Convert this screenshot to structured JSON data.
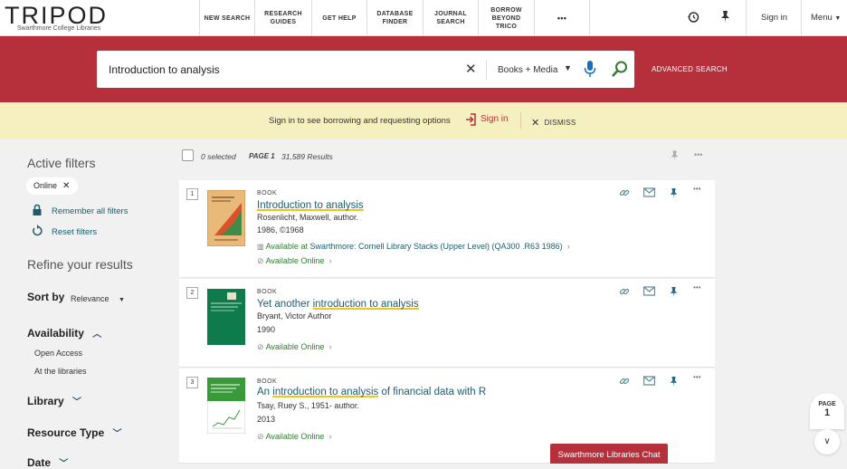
{
  "brand": {
    "title": "TRIPOD",
    "subtitle": "Swarthmore College Libraries"
  },
  "nav": {
    "new_search": "NEW SEARCH",
    "research_guides_1": "RESEARCH",
    "research_guides_2": "GUIDES",
    "get_help": "GET HELP",
    "database_finder_1": "DATABASE",
    "database_finder_2": "FINDER",
    "journal_search_1": "JOURNAL",
    "journal_search_2": "SEARCH",
    "borrow_1": "BORROW",
    "borrow_2": "BEYOND",
    "borrow_3": "TRICO",
    "more": "•••",
    "sign_in": "Sign in",
    "menu": "Menu"
  },
  "search": {
    "query": "Introduction to analysis",
    "scope": "Books + Media",
    "advanced": "ADVANCED SEARCH"
  },
  "banner": {
    "message": "Sign in to see borrowing and requesting options",
    "sign_in": "Sign in",
    "dismiss": "DISMISS"
  },
  "sidebar": {
    "active_filters": "Active filters",
    "chip": "Online",
    "remember": "Remember all filters",
    "reset": "Reset filters",
    "refine": "Refine your results",
    "sort_by": "Sort by",
    "sort_value": "Relevance",
    "availability": "Availability",
    "open_access": "Open Access",
    "at_libraries": "At the libraries",
    "library": "Library",
    "resource_type": "Resource Type",
    "date": "Date"
  },
  "results_header": {
    "selected": "0 selected",
    "page": "PAGE 1",
    "count": "31,589 Results"
  },
  "results": [
    {
      "num": "1",
      "type": "BOOK",
      "title_hl": "Introduction to analysis",
      "title_rest": "",
      "author": "Rosenlicht, Maxwell, author.",
      "date": "1986, ©1968",
      "avail_prefix": "Available at",
      "avail_loc": "Swarthmore: Cornell Library  Stacks (Upper Level) (QA300 .R63 1986)",
      "online": "Available Online"
    },
    {
      "num": "2",
      "type": "BOOK",
      "title_pre": "Yet another ",
      "title_hl": "introduction to analysis",
      "author": "Bryant, Victor Author",
      "date": "1990",
      "online": "Available Online"
    },
    {
      "num": "3",
      "type": "BOOK",
      "title_pre": "An ",
      "title_hl": "introduction to analysis",
      "title_rest": " of financial data with R",
      "author": "Tsay, Ruey S., 1951- author.",
      "date": "2013",
      "online": "Available Online"
    }
  ],
  "pager": {
    "label": "PAGE",
    "num": "1"
  },
  "chat": "Swarthmore Libraries Chat",
  "colors": {
    "brand_red": "#b5303a",
    "banner_yellow": "#f6efc0",
    "link_teal": "#1d5c6b",
    "available_green": "#2e7d32",
    "highlight": "#f0c419"
  }
}
